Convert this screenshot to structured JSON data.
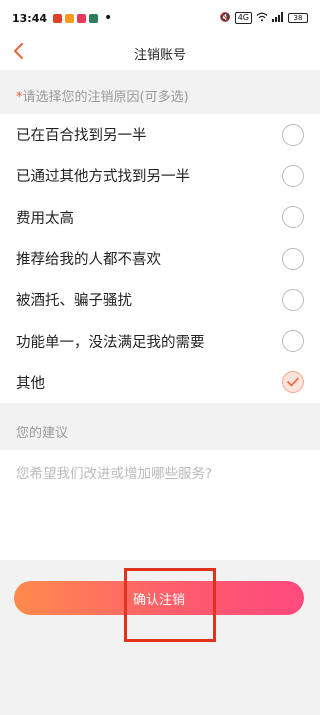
{
  "status_bar": {
    "time": "13:44",
    "notification_icons": [
      {
        "name": "notif-app-1-icon",
        "color": "#e0402a"
      },
      {
        "name": "notif-app-2-icon",
        "color": "#ff9a1f"
      },
      {
        "name": "notif-app-3-icon",
        "color": "#e53a5c"
      },
      {
        "name": "notif-app-4-icon",
        "color": "#2e7d5b"
      }
    ],
    "dot": "•",
    "network_label": "4G",
    "battery": "38"
  },
  "nav": {
    "title": "注销账号",
    "back_icon": "chevron-left-icon",
    "accent_color": "#f0623c"
  },
  "reason_section": {
    "required_mark": "*",
    "hint": "请选择您的注销原因(可多选)"
  },
  "reasons": [
    {
      "label": "已在百合找到另一半",
      "checked": false
    },
    {
      "label": "已通过其他方式找到另一半",
      "checked": false
    },
    {
      "label": "费用太高",
      "checked": false
    },
    {
      "label": "推荐给我的人都不喜欢",
      "checked": false
    },
    {
      "label": "被酒托、骗子骚扰",
      "checked": false
    },
    {
      "label": "功能单一，没法满足我的需要",
      "checked": false
    },
    {
      "label": "其他",
      "checked": true
    }
  ],
  "suggestion": {
    "label": "您的建议",
    "placeholder": "您希望我们改进或增加哪些服务?",
    "value": ""
  },
  "confirm": {
    "label": "确认注销"
  },
  "colors": {
    "checked_fill": "#fde4da",
    "checked_border": "#f7a78c",
    "check_mark": "#f0623c",
    "highlight": "#e0331e"
  }
}
